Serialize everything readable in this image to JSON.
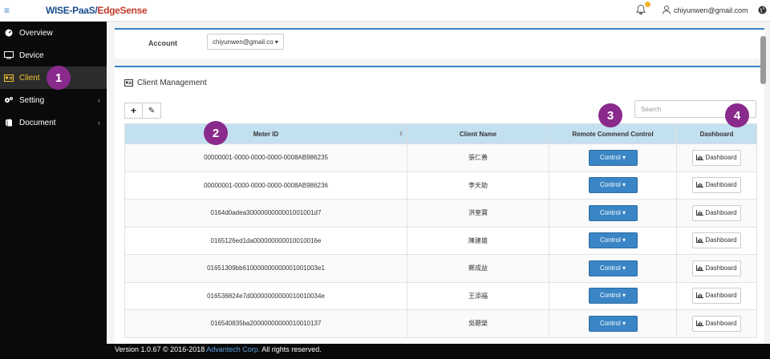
{
  "header": {
    "menu_icon": "hamburger-icon",
    "logo_part1": "WISE-PaaS/",
    "logo_part2": "EdgeSense",
    "user_email": "chiyunwen@gmail.com",
    "colors": {
      "accent": "#3a85c5",
      "sidebar_bg": "#0a0a0a",
      "active": "#f2c12e",
      "callout": "#8a2a8c",
      "table_header": "#c2e0f0"
    }
  },
  "sidebar": {
    "items": [
      {
        "label": "Overview",
        "icon": "dashboard-icon"
      },
      {
        "label": "Device",
        "icon": "monitor-icon"
      },
      {
        "label": "Client",
        "icon": "client-card-icon",
        "active": true
      },
      {
        "label": "Setting",
        "icon": "gears-icon",
        "chevron": "‹"
      },
      {
        "label": "Document",
        "icon": "book-icon",
        "chevron": "‹"
      }
    ]
  },
  "account": {
    "label": "Account",
    "selected": "chiyunwen@gmail.co ▾"
  },
  "client_panel": {
    "title": "Client Management",
    "add_label": "+",
    "edit_label": "✎",
    "search_placeholder": "Search",
    "columns": [
      "Meter ID",
      "Client Name",
      "Remote Commend Control",
      "Dashboard"
    ],
    "control_label": "Control ▾",
    "dashboard_label": "Dashboard",
    "rows": [
      {
        "meter_id": "00000001-0000-0000-0000-0008AB986235",
        "client_name": "張仁善"
      },
      {
        "meter_id": "00000001-0000-0000-0000-0008AB986236",
        "client_name": "李天助"
      },
      {
        "meter_id": "0164d0adea3000000000001001001d7",
        "client_name": "洪奎寶"
      },
      {
        "meter_id": "0165126ed1da000000000010010016e",
        "client_name": "陳建雄"
      },
      {
        "meter_id": "01651309bb610000000000001001003e1",
        "client_name": "鄭成益"
      },
      {
        "meter_id": "016536824e7d00000000000010010034e",
        "client_name": "王添福"
      },
      {
        "meter_id": "016540835ba20000000000010010137",
        "client_name": "吳聰榮"
      }
    ]
  },
  "callouts": [
    "1",
    "2",
    "3",
    "4"
  ],
  "footer": {
    "prefix": "Version 1.0.67 © 2016-2018 ",
    "link": "Advantech Corp.",
    "suffix": " All rights reserved."
  }
}
